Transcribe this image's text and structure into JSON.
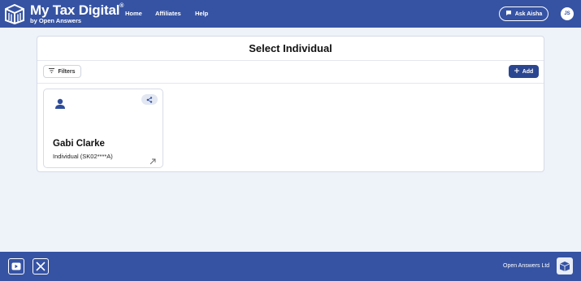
{
  "header": {
    "brand_title": "My Tax Digital",
    "brand_mark": "®",
    "brand_sub": "by Open Answers",
    "nav": [
      "Home",
      "Affiliates",
      "Help"
    ],
    "ask_button": "Ask Aisha",
    "avatar_initials": "JS"
  },
  "main": {
    "title": "Select Individual",
    "filters_label": "Filters",
    "add_label": "Add",
    "cards": [
      {
        "name": "Gabi Clarke",
        "detail": "Individual (SK02****A)"
      }
    ]
  },
  "footer": {
    "company": "Open Answers Ltd",
    "icons": [
      "youtube-icon",
      "x-icon",
      "logo-icon"
    ]
  },
  "colors": {
    "header_bg": "#3653a3",
    "page_bg": "#eef2f9",
    "add_button": "#2b4690",
    "accent_icon": "#2f4d9a"
  }
}
